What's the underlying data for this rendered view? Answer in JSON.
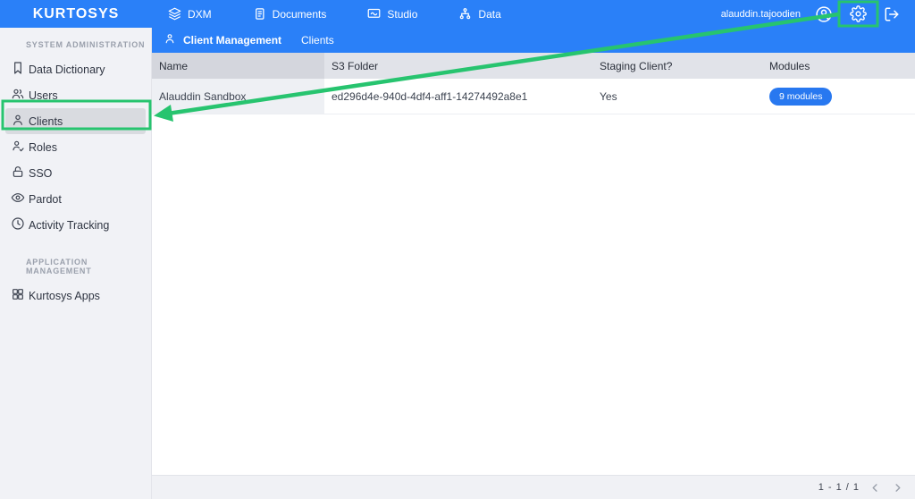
{
  "brand": "KURTOSYS",
  "topnav": {
    "items": [
      {
        "label": "DXM",
        "icon": "layers"
      },
      {
        "label": "Documents",
        "icon": "document"
      },
      {
        "label": "Studio",
        "icon": "studio-board"
      },
      {
        "label": "Data",
        "icon": "sitemap"
      }
    ]
  },
  "user": {
    "name": "alauddin.tajoodien",
    "avatar_icon": "user-circle",
    "settings_icon": "gear",
    "logout_icon": "log-out"
  },
  "sidebar": {
    "sections": [
      {
        "title": "SYSTEM ADMINISTRATION",
        "items": [
          {
            "label": "Data Dictionary",
            "icon": "bookmark",
            "selected": false
          },
          {
            "label": "Users",
            "icon": "users",
            "selected": false
          },
          {
            "label": "Clients",
            "icon": "person",
            "selected": true
          },
          {
            "label": "Roles",
            "icon": "person-check",
            "selected": false
          },
          {
            "label": "SSO",
            "icon": "lock",
            "selected": false
          },
          {
            "label": "Pardot",
            "icon": "eye",
            "selected": false
          },
          {
            "label": "Activity Tracking",
            "icon": "clock",
            "selected": false
          }
        ]
      },
      {
        "title": "APPLICATION MANAGEMENT",
        "items": [
          {
            "label": "Kurtosys Apps",
            "icon": "grid",
            "selected": false
          }
        ]
      }
    ]
  },
  "breadcrumb": {
    "section": "Client Management",
    "section_icon": "person",
    "page": "Clients"
  },
  "table": {
    "columns": [
      "Name",
      "S3 Folder",
      "Staging Client?",
      "Modules"
    ],
    "rows": [
      {
        "name": "Alauddin Sandbox",
        "s3_folder": "ed296d4e-940d-4df4-aff1-14274492a8e1",
        "staging": "Yes",
        "modules_badge": "9 modules"
      }
    ]
  },
  "pagination": {
    "label": "1 - 1 / 1"
  },
  "annotations": {
    "highlight_1": "settings-gear-box",
    "highlight_2": "sidebar-clients-box",
    "arrow": "from settings gear to Clients sidebar item"
  },
  "colors": {
    "primary_blue": "#2a80f8",
    "badge_blue": "#2878f0",
    "annotation_green": "#27c46f",
    "sidebar_bg": "#f1f2f6",
    "header_cell_bg": "#e1e3e9",
    "sorted_header_bg": "#d4d6dd"
  }
}
